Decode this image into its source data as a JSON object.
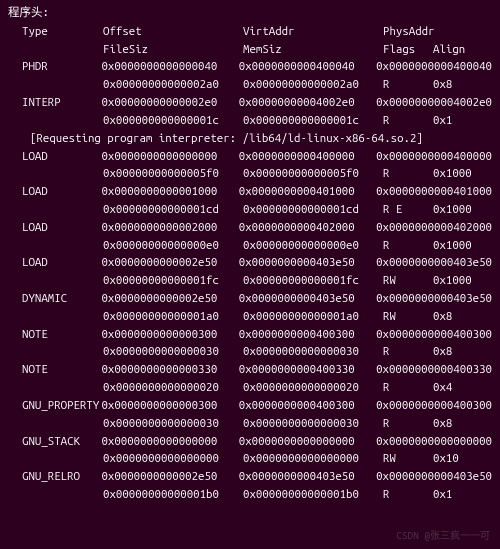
{
  "title": "程序头:",
  "headers": {
    "type": "Type",
    "offset": "Offset",
    "virt": "VirtAddr",
    "phys": "PhysAddr",
    "filesz": "FileSiz",
    "memsz": "MemSiz",
    "flags": "Flags",
    "align": "Align"
  },
  "rows": [
    {
      "type": "PHDR",
      "offset": "0x0000000000000040",
      "virt": "0x0000000000400040",
      "phys": "0x0000000000400040",
      "filesz": "0x00000000000002a0",
      "memsz": "0x00000000000002a0",
      "flags": "R",
      "align": "0x8"
    },
    {
      "type": "INTERP",
      "offset": "0x00000000000002e0",
      "virt": "0x00000000004002e0",
      "phys": "0x00000000004002e0",
      "filesz": "0x000000000000001c",
      "memsz": "0x000000000000001c",
      "flags": "R",
      "align": "0x1",
      "note": "[Requesting program interpreter: /lib64/ld-linux-x86-64.so.2]"
    },
    {
      "type": "LOAD",
      "offset": "0x0000000000000000",
      "virt": "0x0000000000400000",
      "phys": "0x0000000000400000",
      "filesz": "0x00000000000005f0",
      "memsz": "0x00000000000005f0",
      "flags": "R",
      "align": "0x1000"
    },
    {
      "type": "LOAD",
      "offset": "0x0000000000001000",
      "virt": "0x0000000000401000",
      "phys": "0x0000000000401000",
      "filesz": "0x00000000000001cd",
      "memsz": "0x00000000000001cd",
      "flags": "R E",
      "align": "0x1000"
    },
    {
      "type": "LOAD",
      "offset": "0x0000000000002000",
      "virt": "0x0000000000402000",
      "phys": "0x0000000000402000",
      "filesz": "0x00000000000000e0",
      "memsz": "0x00000000000000e0",
      "flags": "R",
      "align": "0x1000"
    },
    {
      "type": "LOAD",
      "offset": "0x0000000000002e50",
      "virt": "0x0000000000403e50",
      "phys": "0x0000000000403e50",
      "filesz": "0x00000000000001fc",
      "memsz": "0x00000000000001fc",
      "flags": "RW",
      "align": "0x1000"
    },
    {
      "type": "DYNAMIC",
      "offset": "0x0000000000002e50",
      "virt": "0x0000000000403e50",
      "phys": "0x0000000000403e50",
      "filesz": "0x00000000000001a0",
      "memsz": "0x00000000000001a0",
      "flags": "RW",
      "align": "0x8"
    },
    {
      "type": "NOTE",
      "offset": "0x0000000000000300",
      "virt": "0x0000000000400300",
      "phys": "0x0000000000400300",
      "filesz": "0x0000000000000030",
      "memsz": "0x0000000000000030",
      "flags": "R",
      "align": "0x8"
    },
    {
      "type": "NOTE",
      "offset": "0x0000000000000330",
      "virt": "0x0000000000400330",
      "phys": "0x0000000000400330",
      "filesz": "0x0000000000000020",
      "memsz": "0x0000000000000020",
      "flags": "R",
      "align": "0x4"
    },
    {
      "type": "GNU_PROPERTY",
      "offset": "0x0000000000000300",
      "virt": "0x0000000000400300",
      "phys": "0x0000000000400300",
      "filesz": "0x0000000000000030",
      "memsz": "0x0000000000000030",
      "flags": "R",
      "align": "0x8"
    },
    {
      "type": "GNU_STACK",
      "offset": "0x0000000000000000",
      "virt": "0x0000000000000000",
      "phys": "0x0000000000000000",
      "filesz": "0x0000000000000000",
      "memsz": "0x0000000000000000",
      "flags": "RW",
      "align": "0x10"
    },
    {
      "type": "GNU_RELRO",
      "offset": "0x0000000000002e50",
      "virt": "0x0000000000403e50",
      "phys": "0x0000000000403e50",
      "filesz": "0x00000000000001b0",
      "memsz": "0x00000000000001b0",
      "flags": "R",
      "align": "0x1"
    }
  ],
  "watermark": "CSDN @张三疯一一可"
}
